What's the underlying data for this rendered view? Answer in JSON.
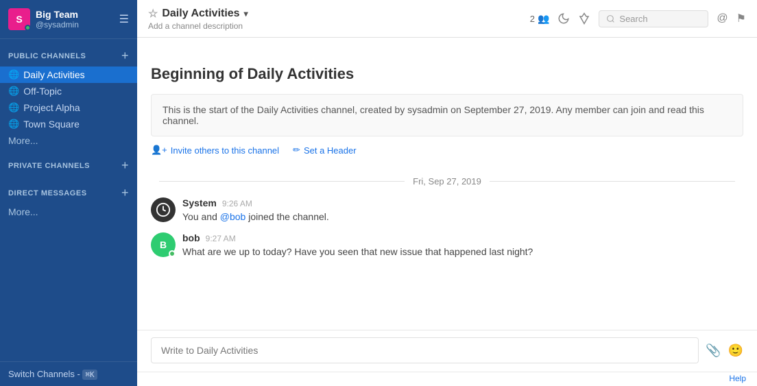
{
  "sidebar": {
    "team_name": "Big Team",
    "team_initial": "S",
    "username": "@sysadmin",
    "menu_icon": "☰",
    "public_channels_label": "PUBLIC CHANNELS",
    "add_icon": "+",
    "channels": [
      {
        "name": "Daily Activities",
        "active": true
      },
      {
        "name": "Off-Topic",
        "active": false
      },
      {
        "name": "Project Alpha",
        "active": false
      },
      {
        "name": "Town Square",
        "active": false
      }
    ],
    "more_label": "More...",
    "private_channels_label": "PRIVATE CHANNELS",
    "direct_messages_label": "DIRECT MESSAGES",
    "direct_more_label": "More...",
    "switch_channels_label": "Switch Channels",
    "switch_shortcut": "⌘K"
  },
  "topbar": {
    "channel_name": "Daily Activities",
    "channel_desc": "Add a channel description",
    "members_count": "2",
    "search_placeholder": "Search"
  },
  "chat": {
    "beginning_title": "Beginning of Daily Activities",
    "info_text": "This is the start of the Daily Activities channel, created by sysadmin on September 27, 2019. Any member can join and read this channel.",
    "invite_label": "Invite others to this channel",
    "header_label": "Set a Header",
    "date_divider": "Fri, Sep 27, 2019",
    "messages": [
      {
        "author": "System",
        "time": "9:26 AM",
        "text_before": "You and ",
        "mention": "@bob",
        "text_after": " joined the channel.",
        "avatar_type": "system",
        "avatar_letter": ""
      },
      {
        "author": "bob",
        "time": "9:27 AM",
        "text": "What are we up to today?  Have you seen that new issue that happened last night?",
        "avatar_type": "bob",
        "avatar_letter": "B"
      }
    ]
  },
  "input": {
    "placeholder": "Write to Daily Activities"
  },
  "footer": {
    "help_label": "Help"
  }
}
